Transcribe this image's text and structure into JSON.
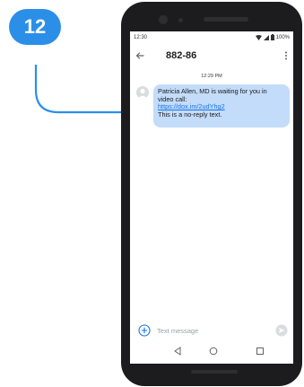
{
  "step": {
    "number": "12"
  },
  "status_bar": {
    "time": "12:30",
    "battery": "100%"
  },
  "conversation": {
    "title": "882-86"
  },
  "message": {
    "timestamp": "12:29 PM",
    "lines": [
      "Patricia Allen, MD is waiting for you in",
      "video call:"
    ],
    "link": "https://dox.im/2udYhg2",
    "footer": "This is a no-reply text."
  },
  "compose": {
    "placeholder": "Text message"
  },
  "icons": {
    "back": "arrow-left-icon",
    "menu": "more-vert-icon",
    "add": "plus-circle-icon",
    "send": "send-icon",
    "wifi": "wifi-icon",
    "signal": "signal-icon",
    "battery": "battery-icon"
  },
  "colors": {
    "badge": "#2b8fe8",
    "bubble": "#c3dcf9",
    "link": "#1a73e8",
    "phone": "#1c1c1e"
  }
}
